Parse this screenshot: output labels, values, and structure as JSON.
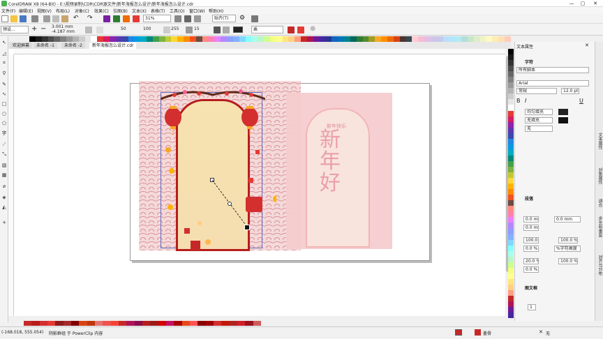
{
  "window": {
    "title": "CorelDRAW X8 (64-Bit) - E:\\视频录制\\CDR\\CDR源文件\\新年海报怎么设计\\新年海报怎么设计.cdr",
    "controls": [
      "—",
      "▢",
      "✕"
    ]
  },
  "menu": [
    "文件(F)",
    "编辑(E)",
    "视图(V)",
    "布局(L)",
    "对象(C)",
    "效果(C)",
    "位图(B)",
    "文本(X)",
    "表格(T)",
    "工具(O)",
    "窗口(W)",
    "帮助(H)"
  ],
  "toolbar1": {
    "zoom": "31%",
    "snap": "贴齐(T)"
  },
  "toolbar2": {
    "preset": "预设...",
    "width": "3.001 mm",
    "height": "-4.187 mm",
    "value_50": "50",
    "value_100": "100",
    "value_255": "255",
    "value_15": "15",
    "blend_mode": "乘"
  },
  "tabs": [
    "欢迎屏幕",
    "未命名 -1",
    "未命名 -2",
    "新年海报怎么设计.cdr"
  ],
  "poster": {
    "title_chars": [
      "新",
      "年",
      "好"
    ],
    "small_text": "新年快乐"
  },
  "panel": {
    "header": "文本属性",
    "char_section": "字符",
    "script": "所有脚本",
    "font": "Arial",
    "style": "常规",
    "size": "12.0 pt",
    "fill1": "均匀填充",
    "fill2": "无填充",
    "fill3": "无",
    "para_section": "段落",
    "indent1": "0.0 mm",
    "indent2": "0.0 mm",
    "indent3": "0.0 mm",
    "spacing1": "100.0 %",
    "spacing2": "100.0 %",
    "spacing3": "0.0 %",
    "spacing_mode": "%字符高度",
    "spacing4": "20.0 %",
    "spacing5": "100.0 %",
    "spacing6": "0.0 %",
    "frame_section": "图文框",
    "frame_value": "1"
  },
  "dock_tabs": [
    "文本属性",
    "对象属性",
    "调合",
    "步长和重复",
    "对齐与分布"
  ],
  "status": {
    "coords": "(-168.018, 555.054)",
    "message": "阴影群组 于 PowerClip 内容",
    "fill_label": "墨骨",
    "outline_label": "无"
  },
  "colors": {
    "accent": "#c62828",
    "poster_red": "#b71c1c",
    "palette": [
      "#000000",
      "#1a1a1a",
      "#333333",
      "#4d4d4d",
      "#666666",
      "#808080",
      "#999999",
      "#b3b3b3",
      "#cccccc",
      "#e6e6e6",
      "#ffffff",
      "#e53935",
      "#d81b60",
      "#8e24aa",
      "#5e35b1",
      "#3949ab",
      "#1e88e5",
      "#039be5",
      "#00acc1",
      "#00897b",
      "#43a047",
      "#7cb342",
      "#c0ca33",
      "#fdd835",
      "#ffb300",
      "#fb8c00",
      "#f4511e",
      "#6d4c41",
      "#ff8a80",
      "#ff80ab",
      "#ea80fc",
      "#b388ff",
      "#8c9eff",
      "#82b1ff",
      "#80d8ff",
      "#84ffff",
      "#a7ffeb",
      "#b9f6ca",
      "#ccff90",
      "#f4ff81",
      "#ffff8d",
      "#ffe57f",
      "#ffd180",
      "#ff9e80",
      "#c62828",
      "#ad1457",
      "#6a1b9a",
      "#4527a0",
      "#283593",
      "#1565c0",
      "#0277bd",
      "#00838f",
      "#00695c",
      "#2e7d32",
      "#558b2f",
      "#9e9d24",
      "#f9a825",
      "#ff8f00",
      "#ef6c00",
      "#d84315",
      "#4e342e",
      "#37474f",
      "#ffcdd2",
      "#f8bbd0",
      "#e1bee7",
      "#d1c4e9",
      "#c5cae9",
      "#bbdefb",
      "#b3e5fc",
      "#b2ebf2",
      "#b2dfdb",
      "#c8e6c9",
      "#dcedc8",
      "#f0f4c3",
      "#fff9c4",
      "#ffecb3",
      "#ffe0b2",
      "#ffccbc"
    ],
    "bottom_palette": [
      "#c62828",
      "#b71c1c",
      "#d32f2f",
      "#e53935",
      "#8e1b1b",
      "#a52a2a",
      "#7f0000",
      "#d84315",
      "#bf360c",
      "#e57373",
      "#ef5350",
      "#f44336",
      "#c62828",
      "#ad1457",
      "#880e4f",
      "#b71c1c",
      "#9c1a1a",
      "#d50000",
      "#c51162",
      "#aa0000",
      "#e64a19",
      "#ff5252",
      "#8b0000",
      "#a00000",
      "#d32f2f",
      "#c21807",
      "#b22222",
      "#ce2029",
      "#9b111e",
      "#cd5c5c"
    ]
  }
}
